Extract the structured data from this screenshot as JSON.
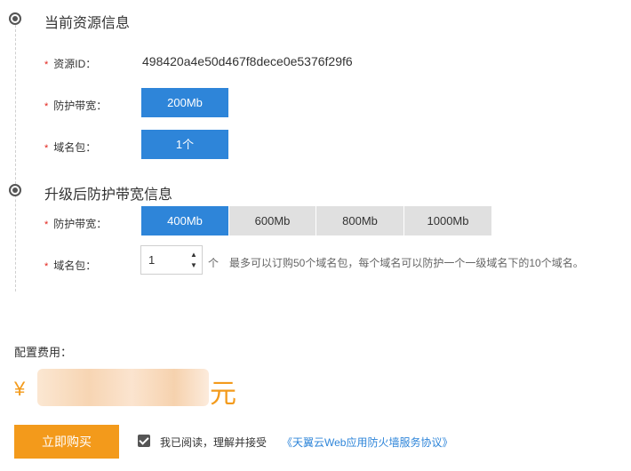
{
  "current_resource": {
    "title": "当前资源信息",
    "required_mark": "*",
    "resource_id_label": "资源ID：",
    "resource_id_value": "498420a4e50d467f8dece0e5376f29f6",
    "bandwidth_label": "防护带宽：",
    "bandwidth_value": "200Mb",
    "domain_pack_label": "域名包：",
    "domain_pack_value": "1个"
  },
  "upgrade": {
    "title": "升级后防护带宽信息",
    "required_mark": "*",
    "bandwidth_label": "防护带宽：",
    "bandwidth_options": [
      "400Mb",
      "600Mb",
      "800Mb",
      "1000Mb"
    ],
    "selected_bandwidth": "400Mb",
    "domain_pack_label": "域名包：",
    "domain_pack_quantity": "1",
    "domain_pack_unit": "个",
    "domain_pack_hint": "最多可以订购50个域名包，每个域名可以防护一个一级域名下的10个域名。"
  },
  "fee": {
    "label": "配置费用：",
    "currency_symbol": "¥",
    "unit": "元"
  },
  "actions": {
    "buy_label": "立即购买",
    "agree_checked": true,
    "agree_text": "我已阅读，理解并接受",
    "agreement_link": "《天翼云Web应用防火墙服务协议》"
  },
  "colors": {
    "accent_blue": "#2e85d9",
    "accent_orange": "#f39a1b",
    "required_red": "#e2231a"
  }
}
